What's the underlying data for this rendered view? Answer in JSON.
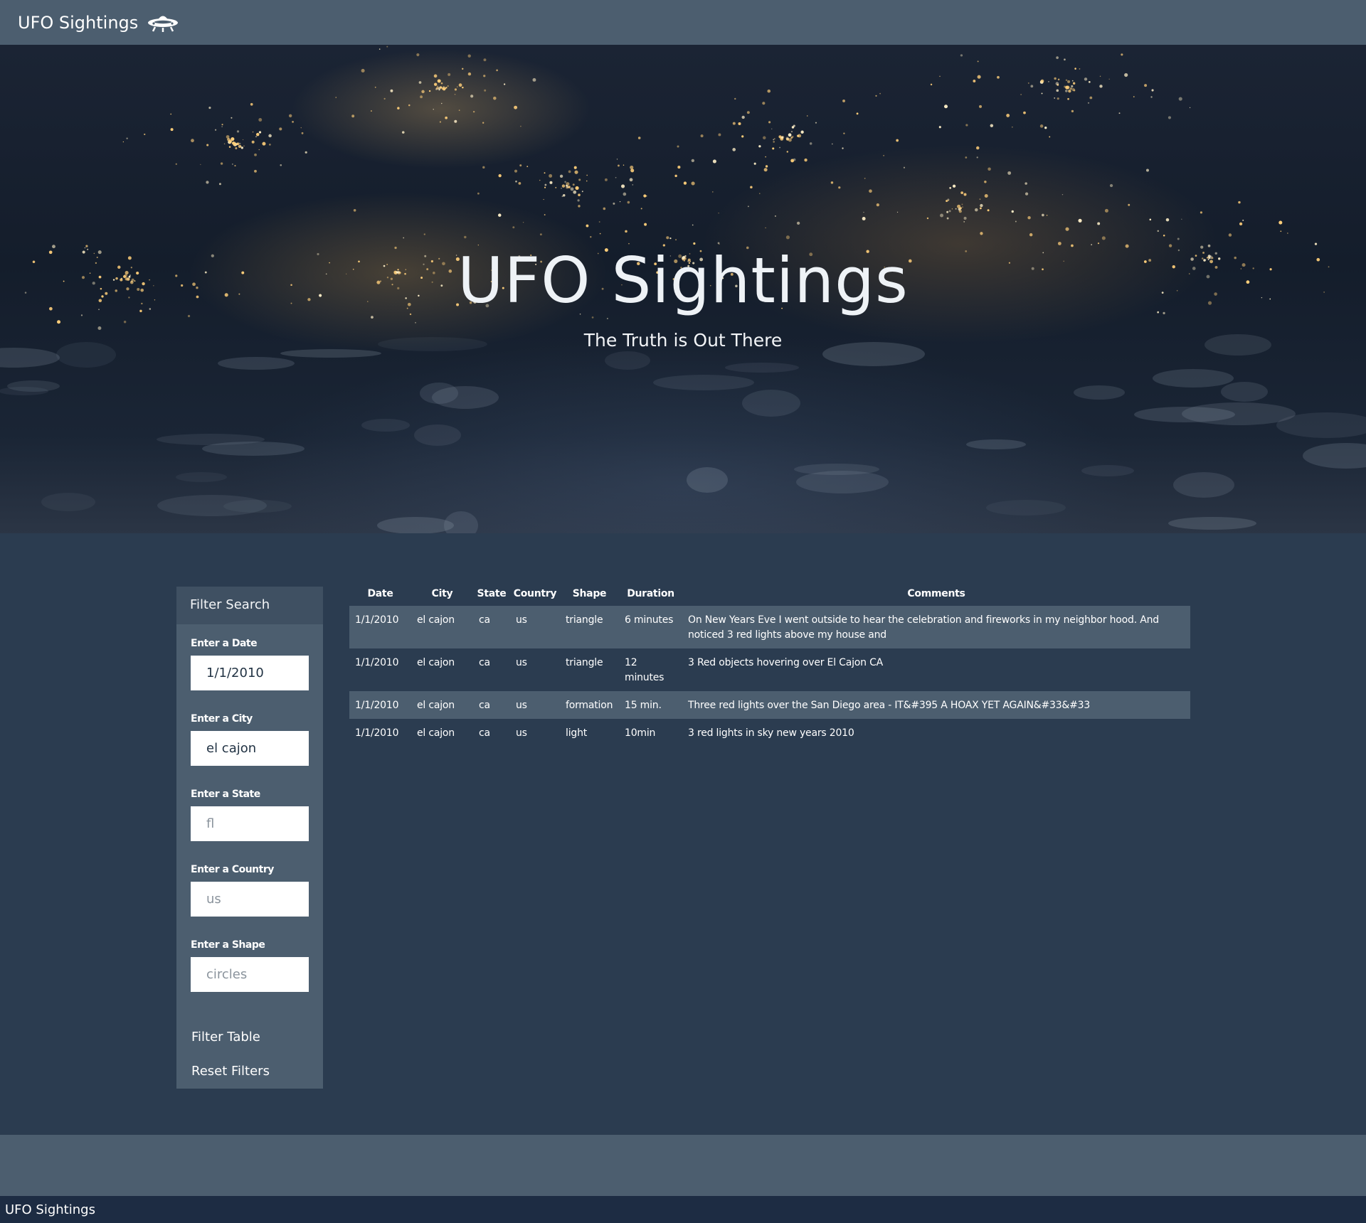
{
  "navbar": {
    "brand": "UFO Sightings",
    "icon": "ufo-icon"
  },
  "hero": {
    "title": "UFO Sightings",
    "subtitle": "The Truth is Out There"
  },
  "filters": {
    "heading": "Filter Search",
    "date": {
      "label": "Enter a Date",
      "value": "1/1/2010",
      "placeholder": ""
    },
    "city": {
      "label": "Enter a City",
      "value": "el cajon",
      "placeholder": ""
    },
    "state": {
      "label": "Enter a State",
      "value": "",
      "placeholder": "fl"
    },
    "country": {
      "label": "Enter a Country",
      "value": "",
      "placeholder": "us"
    },
    "shape": {
      "label": "Enter a Shape",
      "value": "",
      "placeholder": "circles"
    },
    "filter_button": "Filter Table",
    "reset_button": "Reset Filters"
  },
  "table": {
    "headers": [
      "Date",
      "City",
      "State",
      "Country",
      "Shape",
      "Duration",
      "Comments"
    ],
    "rows": [
      [
        "1/1/2010",
        "el cajon",
        "ca",
        "us",
        "triangle",
        "6 minutes",
        "On New Years Eve I went outside to hear the celebration and fireworks in my neighbor hood. And noticed 3 red lights above my house and"
      ],
      [
        "1/1/2010",
        "el cajon",
        "ca",
        "us",
        "triangle",
        "12 minutes",
        "3 Red objects hovering over El Cajon CA"
      ],
      [
        "1/1/2010",
        "el cajon",
        "ca",
        "us",
        "formation",
        "15 min.",
        "Three red lights over the San Diego area - IT&#395 A HOAX YET AGAIN&#33&#33"
      ],
      [
        "1/1/2010",
        "el cajon",
        "ca",
        "us",
        "light",
        "10min",
        "3 red lights in sky new years 2010"
      ]
    ]
  },
  "footer": {
    "text": "UFO Sightings"
  },
  "colors": {
    "navbar": "#4c5e6f",
    "page_background": "#2b3c50",
    "footer_bar": "#1d2c43",
    "striped_row": "#4c5e6f"
  }
}
